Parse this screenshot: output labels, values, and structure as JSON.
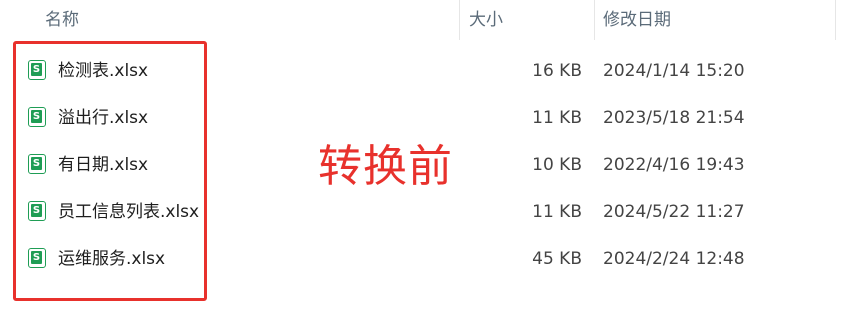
{
  "columns": {
    "name": "名称",
    "size": "大小",
    "modified": "修改日期"
  },
  "files": [
    {
      "name": "检测表.xlsx",
      "size": "16 KB",
      "modified": "2024/1/14 15:20",
      "icon": "excel-file-icon"
    },
    {
      "name": "溢出行.xlsx",
      "size": "11 KB",
      "modified": "2023/5/18 21:54",
      "icon": "excel-file-icon"
    },
    {
      "name": "有日期.xlsx",
      "size": "10 KB",
      "modified": "2022/4/16 19:43",
      "icon": "excel-file-icon"
    },
    {
      "name": "员工信息列表.xlsx",
      "size": "11 KB",
      "modified": "2024/5/22 11:27",
      "icon": "excel-file-icon"
    },
    {
      "name": "运维服务.xlsx",
      "size": "45 KB",
      "modified": "2024/2/24 12:48",
      "icon": "excel-file-icon"
    }
  ],
  "file_icon_glyph": "S",
  "annotation": {
    "text": "转换前",
    "color": "#e8312c"
  },
  "colors": {
    "excel_green": "#1f9d55",
    "highlight_red": "#e8312c"
  }
}
